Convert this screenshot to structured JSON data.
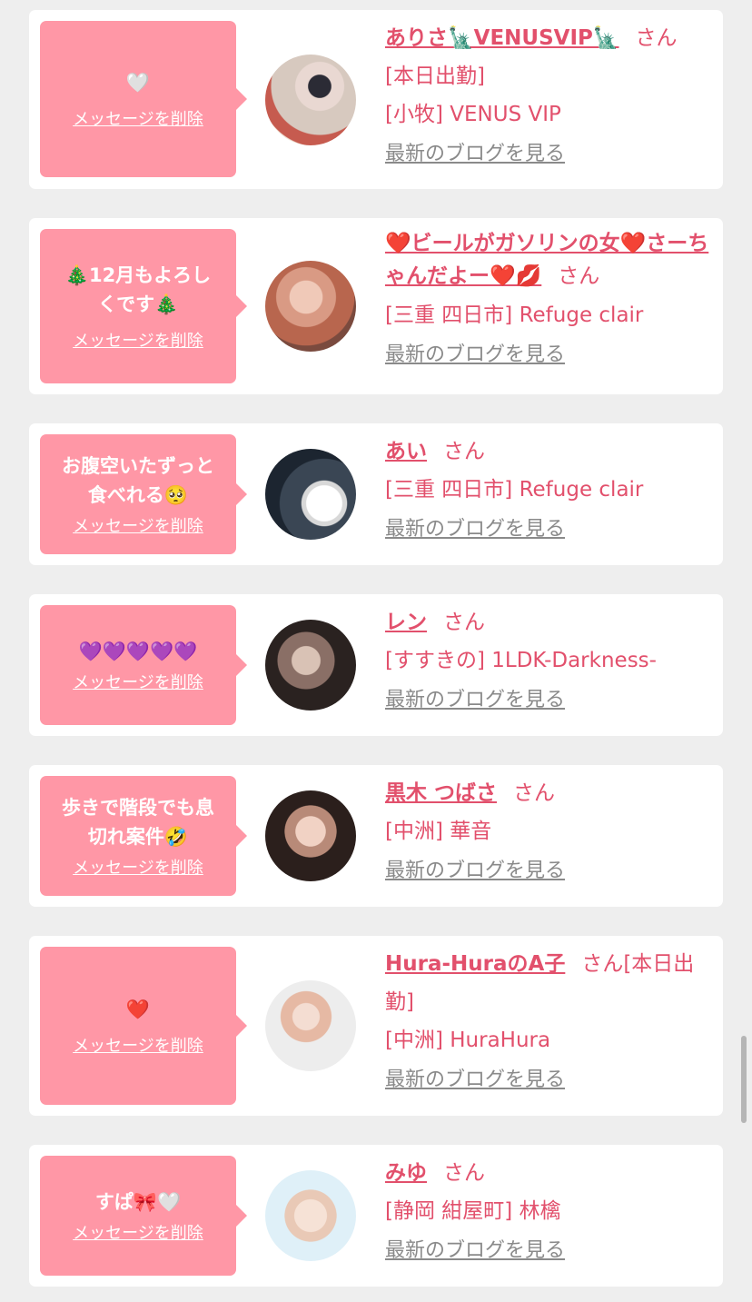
{
  "delete_label": "メッセージを削除",
  "honorific": "さん",
  "blog_label": "最新のブログを見る",
  "messages": [
    {
      "message": "🤍",
      "name": "ありさ🗽VENUSVIP🗽",
      "status": "[本日出勤]",
      "shop": "[小牧] VENUS VIP"
    },
    {
      "message": "🎄12月もよろし\nくです🎄",
      "name": "❤️ビールがガソリンの女❤️さーちゃんだよー❤️💋",
      "status": "",
      "shop": "[三重 四日市] Refuge clair"
    },
    {
      "message": "お腹空いたずっと\n食べれる🥺",
      "name": "あい",
      "status": "",
      "shop": "[三重 四日市] Refuge clair"
    },
    {
      "message": "💜💜💜💜💜",
      "name": "レン",
      "status": "",
      "shop": "[すすきの] 1LDK-Darkness-"
    },
    {
      "message": "歩きで階段でも息\n切れ案件🤣",
      "name": "黒木 つばさ",
      "status": "",
      "shop": "[中洲] 華音"
    },
    {
      "message": "❤️",
      "name": "Hura-HuraのA子",
      "status": "[本日出勤]",
      "shop": "[中洲] HuraHura"
    },
    {
      "message": "すぱ🎀🤍",
      "name": "みゆ",
      "status": "",
      "shop": "[静岡 紺屋町] 林檎"
    }
  ],
  "colors": {
    "bubble": "#ff97a6",
    "accent": "#e2506c",
    "link_gray": "#8a8a8a",
    "background": "#eeeeee"
  }
}
